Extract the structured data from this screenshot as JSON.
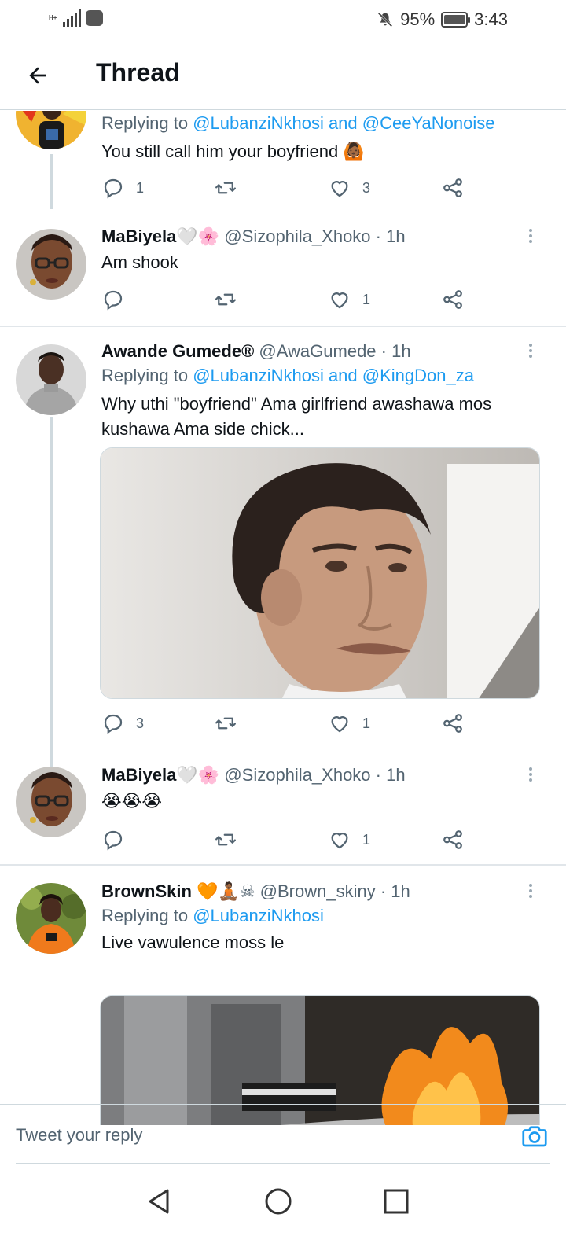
{
  "status_bar": {
    "network": "H+",
    "battery_percent": "95%",
    "time": "3:43"
  },
  "header": {
    "title": "Thread"
  },
  "tweets": [
    {
      "replying_prefix": "Replying to ",
      "mentions": "@LubanziNkhosi and @CeeYaNonoise",
      "text": "You still call him your boyfriend 🙆🏾",
      "reply_count": "1",
      "retweet_count": "",
      "like_count": "3"
    },
    {
      "name": "MaBiyela",
      "name_emoji": "🤍🌸",
      "handle": "@Sizophila_Xhoko",
      "time": "· 1h",
      "text": "Am shook",
      "reply_count": "",
      "retweet_count": "",
      "like_count": "1"
    },
    {
      "name": "Awande Gumede®",
      "handle": "@AwaGumede",
      "time": "· 1h",
      "replying_prefix": "Replying to ",
      "mentions": "@LubanziNkhosi and @KingDon_za",
      "text": "Why uthi \"boyfriend\" Ama girlfriend awashawa mos kushawa Ama side chick...",
      "reply_count": "3",
      "retweet_count": "",
      "like_count": "1"
    },
    {
      "name": "MaBiyela",
      "name_emoji": "🤍🌸",
      "handle": "@Sizophila_Xhoko",
      "time": "· 1h",
      "text": "😭😭😭",
      "reply_count": "",
      "retweet_count": "",
      "like_count": "1"
    },
    {
      "name": "BrownSkin",
      "name_emoji": "🧡🧘🏾☠",
      "handle": "@Brown_skiny",
      "time": "· 1h",
      "replying_prefix": "Replying to ",
      "mentions": "@LubanziNkhosi",
      "text": "Live vawulence moss le"
    }
  ],
  "composer": {
    "placeholder": "Tweet your reply"
  },
  "colors": {
    "accent": "#1d9bf0",
    "secondary_text": "#536471",
    "divider": "#cfd9de"
  },
  "icons": [
    "back-arrow-icon",
    "reply-icon",
    "retweet-icon",
    "like-icon",
    "share-icon",
    "more-icon",
    "camera-icon",
    "nav-back-icon",
    "nav-home-icon",
    "nav-recents-icon"
  ]
}
